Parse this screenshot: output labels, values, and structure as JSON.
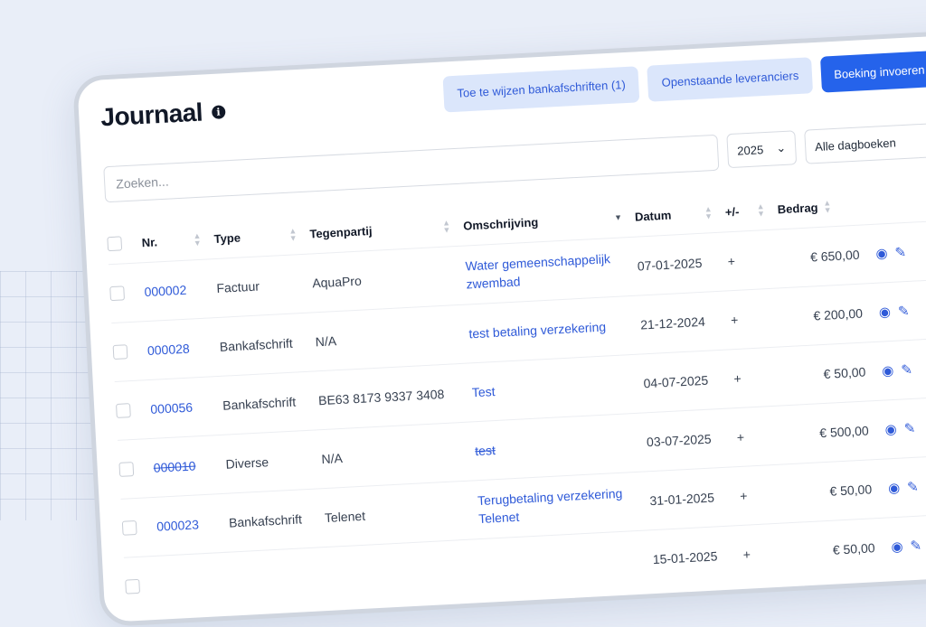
{
  "page": {
    "title": "Journaal",
    "info_icon": "info-icon"
  },
  "actions": {
    "assign_statements": "Toe te wijzen bankafschriften (1)",
    "open_suppliers": "Openstaande leveranciers",
    "new_booking": "Boeking invoeren"
  },
  "filters": {
    "search_placeholder": "Zoeken...",
    "year": "2025",
    "journal": "Alle dagboeken"
  },
  "table": {
    "headers": {
      "nr": "Nr.",
      "type": "Type",
      "party": "Tegenpartij",
      "desc": "Omschrijving",
      "date": "Datum",
      "pm": "+/-",
      "amount": "Bedrag"
    },
    "rows": [
      {
        "nr": "000002",
        "type": "Factuur",
        "party": "AquaPro",
        "desc": "Water gemeenschappelijk zwembad",
        "date": "07-01-2025",
        "pm": "+",
        "amount": "€ 650,00",
        "struck": false
      },
      {
        "nr": "000028",
        "type": "Bankafschrift",
        "party": "N/A",
        "desc": "test betaling verzekering",
        "date": "21-12-2024",
        "pm": "+",
        "amount": "€ 200,00",
        "struck": false
      },
      {
        "nr": "000056",
        "type": "Bankafschrift",
        "party": "BE63 8173 9337 3408",
        "desc": "Test",
        "date": "04-07-2025",
        "pm": "+",
        "amount": "€ 50,00",
        "struck": false
      },
      {
        "nr": "000010",
        "type": "Diverse",
        "party": "N/A",
        "desc": "test",
        "date": "03-07-2025",
        "pm": "+",
        "amount": "€ 500,00",
        "struck": true
      },
      {
        "nr": "000023",
        "type": "Bankafschrift",
        "party": "Telenet",
        "desc": "Terugbetaling verzekering Telenet",
        "date": "31-01-2025",
        "pm": "+",
        "amount": "€ 50,00",
        "struck": false
      },
      {
        "nr": "",
        "type": "",
        "party": "",
        "desc": "",
        "date": "15-01-2025",
        "pm": "+",
        "amount": "€ 50,00",
        "struck": false
      }
    ]
  }
}
